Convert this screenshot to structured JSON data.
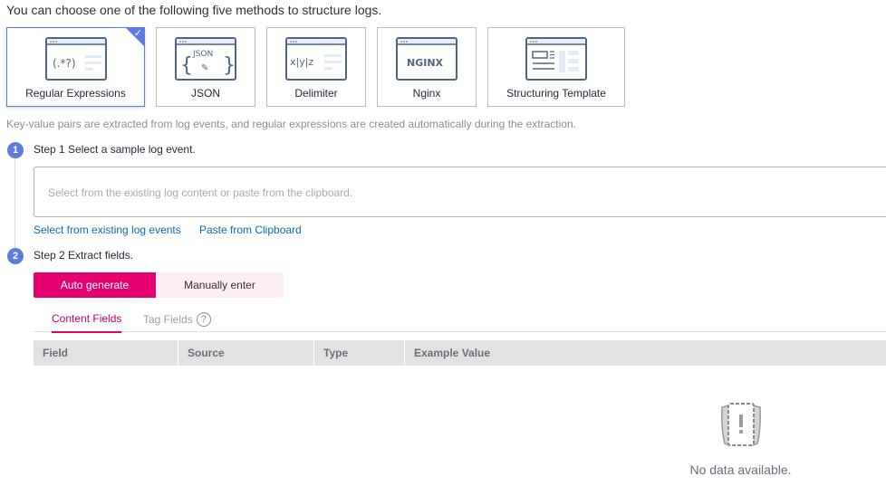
{
  "intro": "You can choose one of the following five methods to structure logs.",
  "methods": [
    {
      "label": "Regular Expressions",
      "icon": "regex-window-icon",
      "selected": true
    },
    {
      "label": "JSON",
      "icon": "json-window-icon",
      "selected": false
    },
    {
      "label": "Delimiter",
      "icon": "delimiter-window-icon",
      "selected": false
    },
    {
      "label": "Nginx",
      "icon": "nginx-window-icon",
      "selected": false
    },
    {
      "label": "Structuring Template",
      "icon": "template-window-icon",
      "selected": false
    }
  ],
  "icon_text": {
    "regex": "(.*?)",
    "json": "JSON",
    "delimiter": "x|y|z",
    "nginx": "NGINX"
  },
  "hint": "Key-value pairs are extracted from log events, and regular expressions are created automatically during the extraction.",
  "step1": {
    "number": "1",
    "title": "Step 1 Select a sample log event.",
    "placeholder": "Select from the existing log content or paste from the clipboard.",
    "links": [
      "Select from existing log events",
      "Paste from Clipboard"
    ]
  },
  "step2": {
    "number": "2",
    "title": "Step 2 Extract fields.",
    "modes": [
      "Auto generate",
      "Manually enter"
    ],
    "active_mode": "Auto generate",
    "tabs": [
      "Content Fields",
      "Tag Fields"
    ],
    "active_tab": "Content Fields",
    "columns": [
      "Field",
      "Source",
      "Type",
      "Example Value"
    ],
    "rows": [],
    "empty_text": "No data available."
  },
  "colors": {
    "accent": "#e6006f",
    "step": "#5e7ce0",
    "link": "#0d6bb0",
    "icon_stroke": "#526580"
  }
}
